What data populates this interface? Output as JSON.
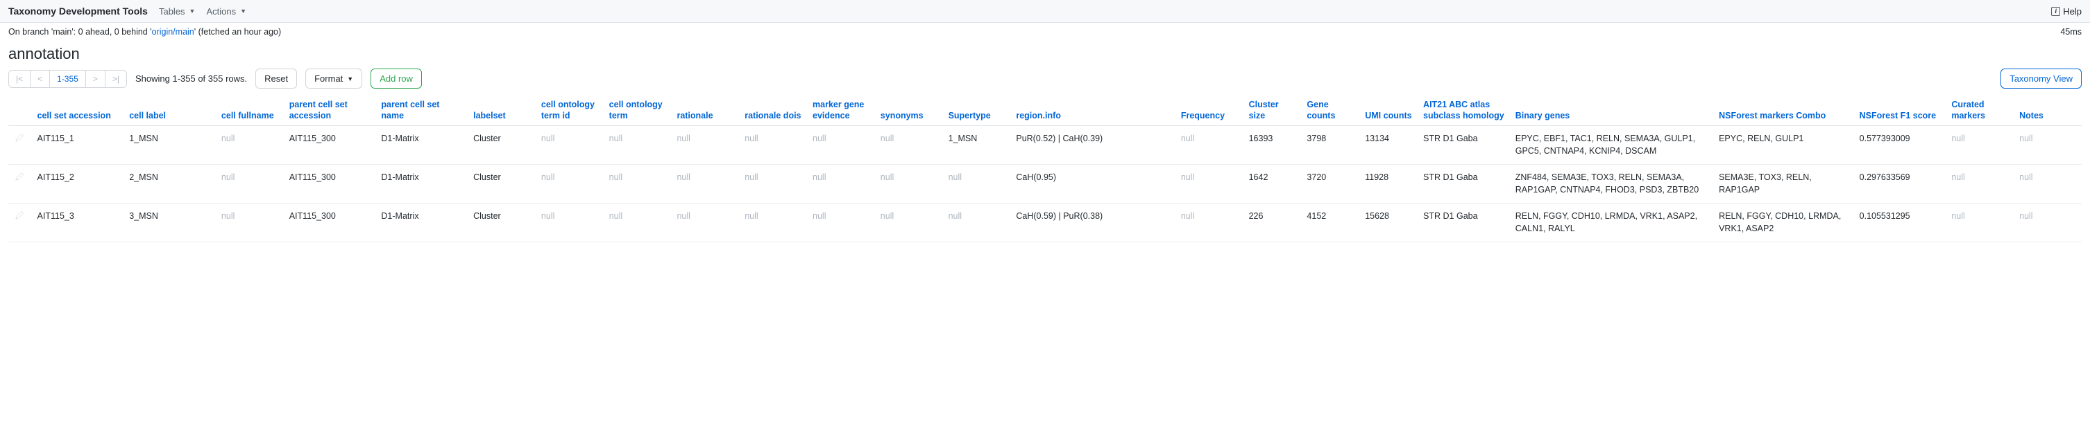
{
  "topbar": {
    "brand": "Taxonomy Development Tools",
    "menu1": "Tables",
    "menu2": "Actions",
    "help": "Help"
  },
  "branch": {
    "prefix": "On branch 'main': 0 ahead, 0 behind '",
    "link": "origin/main",
    "suffix": "' (fetched an hour ago)",
    "timing": "45ms"
  },
  "page": {
    "title": "annotation"
  },
  "toolbar": {
    "range": "1-355",
    "summary": "Showing 1-355 of 355 rows.",
    "reset": "Reset",
    "format": "Format",
    "addrow": "Add row",
    "taxview": "Taxonomy View"
  },
  "columns": [
    "cell set accession",
    "cell label",
    "cell fullname",
    "parent cell set accession",
    "parent cell set name",
    "labelset",
    "cell ontology term id",
    "cell ontology term",
    "rationale",
    "rationale dois",
    "marker gene evidence",
    "synonyms",
    "Supertype",
    "region.info",
    "Frequency",
    "Cluster size",
    "Gene counts",
    "UMI counts",
    "AIT21 ABC atlas subclass homology",
    "Binary genes",
    "NSForest markers Combo",
    "NSForest F1 score",
    "Curated markers",
    "Notes"
  ],
  "rows": [
    {
      "accession": "AIT115_1",
      "label": "1_MSN",
      "fullname": null,
      "parent_acc": "AIT115_300",
      "parent_name": "D1-Matrix",
      "labelset": "Cluster",
      "ont_id": null,
      "ont_term": null,
      "rationale": null,
      "rationale_dois": null,
      "marker": null,
      "synonyms": null,
      "supertype": "1_MSN",
      "region": "PuR(0.52) | CaH(0.39)",
      "frequency": null,
      "cluster_size": "16393",
      "gene_counts": "3798",
      "umi_counts": "13134",
      "homology": "STR D1 Gaba",
      "binary": "EPYC, EBF1, TAC1, RELN, SEMA3A, GULP1, GPC5, CNTNAP4, KCNIP4, DSCAM",
      "nsf_combo": "EPYC, RELN, GULP1",
      "nsf_f1": "0.577393009",
      "curated": null,
      "notes": null
    },
    {
      "accession": "AIT115_2",
      "label": "2_MSN",
      "fullname": null,
      "parent_acc": "AIT115_300",
      "parent_name": "D1-Matrix",
      "labelset": "Cluster",
      "ont_id": null,
      "ont_term": null,
      "rationale": null,
      "rationale_dois": null,
      "marker": null,
      "synonyms": null,
      "supertype": null,
      "region": "CaH(0.95)",
      "frequency": null,
      "cluster_size": "1642",
      "gene_counts": "3720",
      "umi_counts": "11928",
      "homology": "STR D1 Gaba",
      "binary": "ZNF484, SEMA3E, TOX3, RELN, SEMA3A, RAP1GAP, CNTNAP4, FHOD3, PSD3, ZBTB20",
      "nsf_combo": "SEMA3E, TOX3, RELN, RAP1GAP",
      "nsf_f1": "0.297633569",
      "curated": null,
      "notes": null
    },
    {
      "accession": "AIT115_3",
      "label": "3_MSN",
      "fullname": null,
      "parent_acc": "AIT115_300",
      "parent_name": "D1-Matrix",
      "labelset": "Cluster",
      "ont_id": null,
      "ont_term": null,
      "rationale": null,
      "rationale_dois": null,
      "marker": null,
      "synonyms": null,
      "supertype": null,
      "region": "CaH(0.59) | PuR(0.38)",
      "frequency": null,
      "cluster_size": "226",
      "gene_counts": "4152",
      "umi_counts": "15628",
      "homology": "STR D1 Gaba",
      "binary": "RELN, FGGY, CDH10, LRMDA, VRK1, ASAP2, CALN1, RALYL",
      "nsf_combo": "RELN, FGGY, CDH10, LRMDA, VRK1, ASAP2",
      "nsf_f1": "0.105531295",
      "curated": null,
      "notes": null
    }
  ]
}
